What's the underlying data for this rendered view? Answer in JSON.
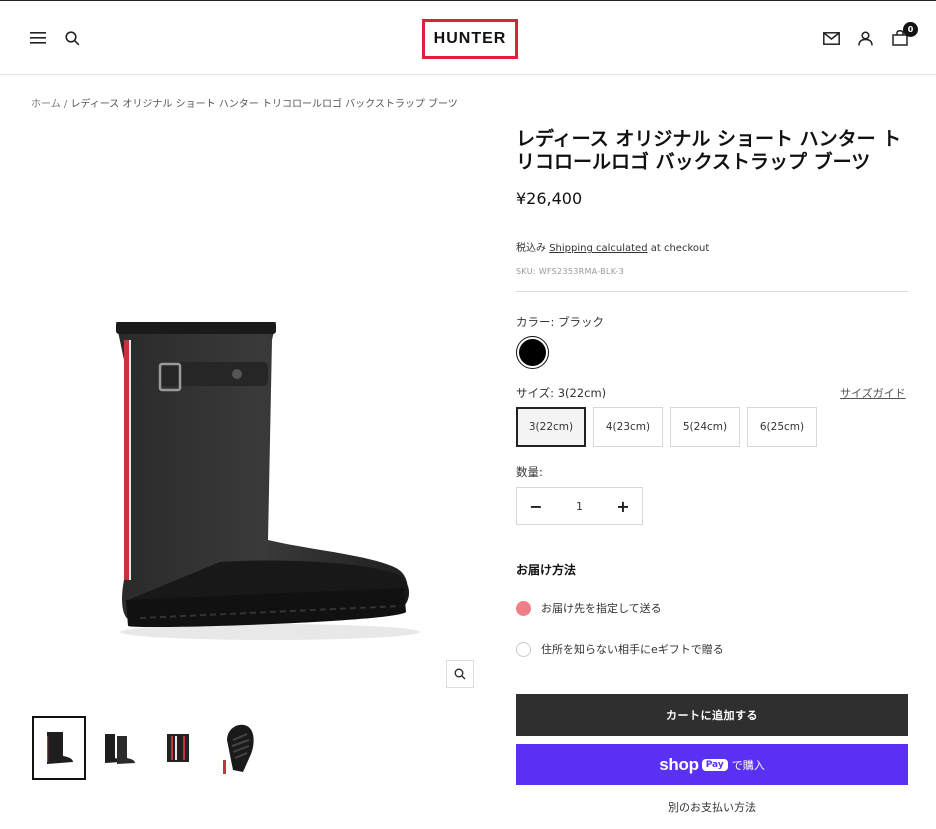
{
  "header": {
    "logo": "HUNTER",
    "cart_count": "0"
  },
  "breadcrumb": {
    "home": "ホーム",
    "separator": " / ",
    "current": "レディース オリジナル ショート ハンター トリコロールロゴ バックストラップ ブーツ"
  },
  "product": {
    "title": "レディース オリジナル ショート ハンター トリコロールロゴ バックストラップ ブーツ",
    "price": "¥26,400",
    "tax_prefix": "税込み",
    "shipping_link": "Shipping calculated",
    "tax_suffix": " at checkout",
    "sku": "SKU: WFS2353RMA-BLK-3"
  },
  "options": {
    "color_label": "カラー:",
    "color_value": "ブラック",
    "swatch_color": "#000000",
    "size_label": "サイズ:",
    "size_value": "3(22cm)",
    "size_guide": "サイズガイド",
    "sizes": [
      "3(22cm)",
      "4(23cm)",
      "5(24cm)",
      "6(25cm)"
    ],
    "quantity_label": "数量:",
    "quantity": "1"
  },
  "delivery": {
    "title": "お届け方法",
    "option1": "お届け先を指定して送る",
    "option2": "住所を知らない相手にeギフトで贈る",
    "selected_color": "#ef7f86"
  },
  "actions": {
    "add_to_cart": "カートに追加する",
    "shop_word": "shop",
    "pay_word": "Pay",
    "buy_text": "で購入",
    "other_payment": "別のお支払い方法",
    "shop_pay_color": "#5a31f4"
  }
}
